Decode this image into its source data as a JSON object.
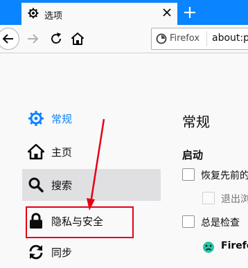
{
  "tab": {
    "title": "选项",
    "icon": "gear-icon"
  },
  "toolbar": {
    "identity_label": "Firefox",
    "url": "about:p"
  },
  "sidebar": {
    "items": [
      {
        "label": "常规",
        "icon": "gear-icon",
        "selected": true
      },
      {
        "label": "主页",
        "icon": "home-icon"
      },
      {
        "label": "搜索",
        "icon": "search-icon",
        "hovered": true
      },
      {
        "label": "隐私与安全",
        "icon": "lock-icon"
      },
      {
        "label": "同步",
        "icon": "sync-icon"
      }
    ]
  },
  "main": {
    "title": "常规",
    "startup": {
      "heading": "启动",
      "restore_label": "恢复先前的",
      "warn_label": "退出浏",
      "default_label": "总是检查",
      "firefox_label": "Firefo"
    }
  },
  "colors": {
    "tabstrip": "#0a84ff",
    "accent": "#0a84ff",
    "annotation": "#e60012"
  }
}
